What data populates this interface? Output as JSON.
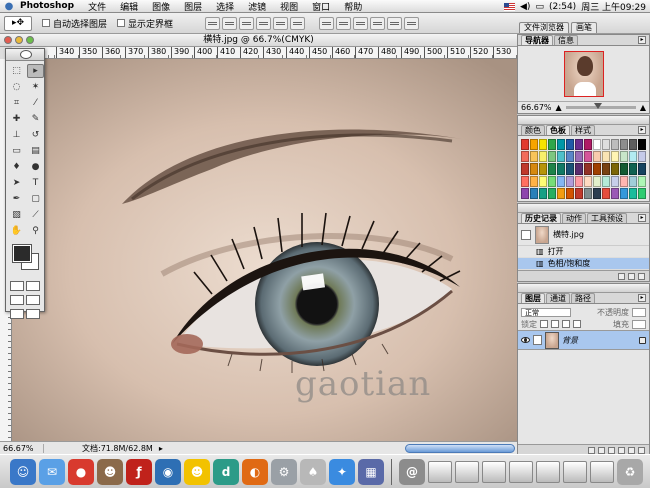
{
  "menubar": {
    "app": "Photoshop",
    "menus": [
      "文件",
      "编辑",
      "图像",
      "图层",
      "选择",
      "滤镜",
      "视图",
      "窗口",
      "帮助"
    ],
    "battery": "(2:54)",
    "clock": "周三 上午09:29"
  },
  "options": {
    "auto_select": "自动选择图层",
    "show_bounds": "显示定界框"
  },
  "well": {
    "tabs": [
      "文件浏览器",
      "画笔"
    ]
  },
  "document": {
    "title": "横特.jpg @ 66.7%(CMYK)",
    "ruler_marks": [
      "340",
      "350",
      "360",
      "370",
      "380",
      "390",
      "400",
      "410",
      "420",
      "430",
      "440",
      "450",
      "460",
      "470",
      "480",
      "490",
      "500",
      "510",
      "520",
      "530"
    ],
    "watermark": "gaotian",
    "zoom": "66.67%",
    "doc_size": "文档:71.8M/62.8M"
  },
  "navigator": {
    "tabs": [
      "导航器",
      "信息"
    ],
    "zoom": "66.67%"
  },
  "color_panel": {
    "tabs": [
      "颜色",
      "色板",
      "样式"
    ],
    "swatches": [
      "#e23b2e",
      "#f6a400",
      "#f5e400",
      "#2ea64a",
      "#0097a8",
      "#1f5aa8",
      "#6a2d8f",
      "#b01a66",
      "#ffffff",
      "#dedede",
      "#bdbdbd",
      "#8d8d8d",
      "#5e5e5e",
      "#000000",
      "#f26b5b",
      "#f8c45a",
      "#f8ef6b",
      "#7dc67f",
      "#4fc0c9",
      "#5a86c8",
      "#9a6bb6",
      "#d5559a",
      "#f8cbad",
      "#fbe4b3",
      "#fff4b3",
      "#c8e6c9",
      "#b2ebf2",
      "#c5cae9",
      "#c0392b",
      "#d68910",
      "#b7950b",
      "#1e8449",
      "#117a65",
      "#1a5276",
      "#5b2c6f",
      "#943126",
      "#a04000",
      "#784212",
      "#7d6608",
      "#145a32",
      "#0e6251",
      "#154360",
      "#ff6f61",
      "#ffb347",
      "#fffd74",
      "#77dd77",
      "#84b6f4",
      "#b19cd9",
      "#ff9aa2",
      "#ffdac1",
      "#e2f0cb",
      "#b5ead7",
      "#c7ceea",
      "#ffb7b2",
      "#a0ced9",
      "#adf7b6",
      "#8e44ad",
      "#2980b9",
      "#16a085",
      "#27ae60",
      "#f39c12",
      "#d35400",
      "#c0392b",
      "#7f8c8d",
      "#2c3e50",
      "#e74c3c",
      "#9b59b6",
      "#3498db",
      "#1abc9c",
      "#2ecc71"
    ]
  },
  "history_panel": {
    "tabs": [
      "历史记录",
      "动作",
      "工具预设"
    ],
    "snapshot": "横特.jpg",
    "items": [
      "打开",
      "色相/饱和度"
    ]
  },
  "layers_panel": {
    "tabs": [
      "图层",
      "通道",
      "路径"
    ],
    "blend_mode": "正常",
    "opacity_label": "不透明度",
    "lock_label": "锁定",
    "fill_label": "填充",
    "layer_name": "背景"
  },
  "dock_icons": [
    {
      "name": "finder-icon",
      "color": "#3a78c8",
      "glyph": "☺"
    },
    {
      "name": "ical-icon",
      "color": "#5aa0e6",
      "glyph": "✉"
    },
    {
      "name": "balloon-icon",
      "color": "#d83a2e",
      "glyph": "●"
    },
    {
      "name": "photo-icon",
      "color": "#8b6a4a",
      "glyph": "☻"
    },
    {
      "name": "flash-icon",
      "color": "#c0221b",
      "glyph": "ƒ"
    },
    {
      "name": "photoshop-icon",
      "color": "#2e6fb4",
      "glyph": "◉"
    },
    {
      "name": "qq-icon",
      "color": "#f2c200",
      "glyph": "☻"
    },
    {
      "name": "dreamweaver-icon",
      "color": "#2c9b88",
      "glyph": "d"
    },
    {
      "name": "firefox-icon",
      "color": "#e06a14",
      "glyph": "◐"
    },
    {
      "name": "preferences-icon",
      "color": "#9aa0a6",
      "glyph": "⚙"
    },
    {
      "name": "apple-icon",
      "color": "#b8b8b8",
      "glyph": "♠"
    },
    {
      "name": "safari-icon",
      "color": "#3a8be0",
      "glyph": "✦"
    },
    {
      "name": "image-viewer-icon",
      "color": "#5a6aa8",
      "glyph": "▦"
    }
  ]
}
